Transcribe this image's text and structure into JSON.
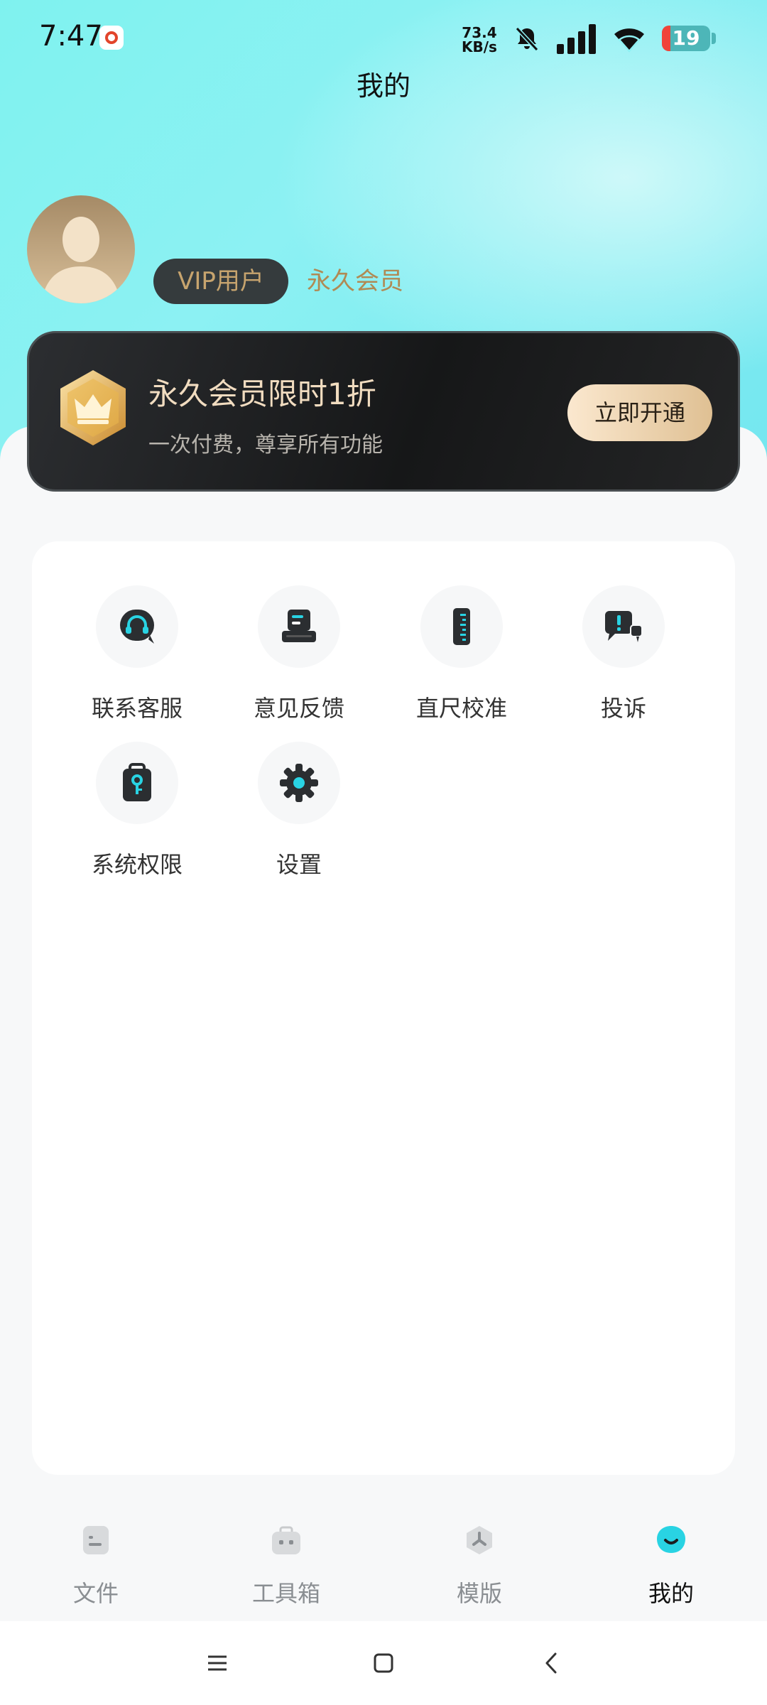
{
  "status_bar": {
    "time": "7:47",
    "net_speed_value": "73.4",
    "net_speed_unit": "KB/s",
    "battery": "19"
  },
  "header": {
    "title": "我的"
  },
  "profile": {
    "vip_tag": "VIP用户",
    "member_status": "永久会员"
  },
  "promo": {
    "title": "永久会员限时1折",
    "subtitle": "一次付费，尊享所有功能",
    "button": "立即开通"
  },
  "grid": {
    "items": [
      {
        "label": "联系客服",
        "icon": "headset-icon"
      },
      {
        "label": "意见反馈",
        "icon": "feedback-icon"
      },
      {
        "label": "直尺校准",
        "icon": "ruler-icon"
      },
      {
        "label": "投诉",
        "icon": "complaint-icon"
      },
      {
        "label": "系统权限",
        "icon": "permission-icon"
      },
      {
        "label": "设置",
        "icon": "gear-icon"
      }
    ]
  },
  "tabs": {
    "items": [
      {
        "label": "文件",
        "icon": "file-icon"
      },
      {
        "label": "工具箱",
        "icon": "toolbox-icon"
      },
      {
        "label": "模版",
        "icon": "template-icon"
      },
      {
        "label": "我的",
        "icon": "profile-icon"
      }
    ],
    "active": "我的"
  },
  "colors": {
    "accent": "#29d3e3",
    "gold": "#b08a54",
    "dark": "#1b1c1e"
  }
}
